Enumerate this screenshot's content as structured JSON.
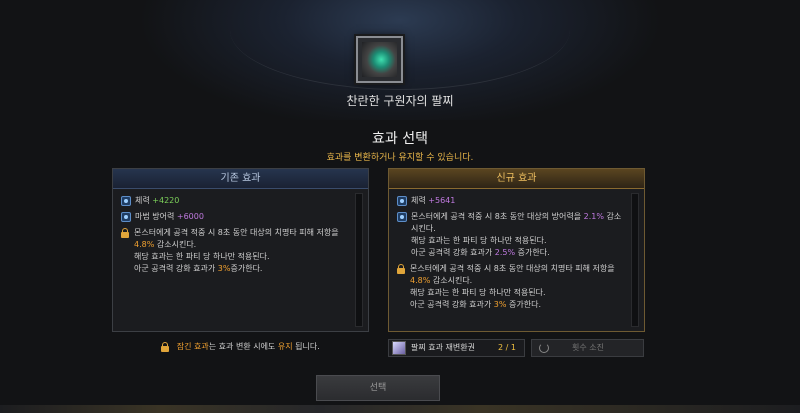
{
  "item": {
    "name": "찬란한 구원자의 팔찌",
    "icon": "bracelet-icon"
  },
  "header": {
    "title": "효과 선택",
    "subtitle": "효과를 변환하거나 유지할 수 있습니다."
  },
  "existing": {
    "header": "기존 효과",
    "lines": [
      {
        "label": "체력",
        "value": "+4220"
      },
      {
        "label": "마법 방어력",
        "value": "+6000"
      }
    ],
    "locked": {
      "line1": "몬스터에게 공격 적중 시 8초 동안 대상의 치명타 피해 저항을",
      "pct": "4.8%",
      "line2": "감소시킨다.",
      "line3": "해당 효과는 한 파티 당 하나만 적용된다.",
      "line4a": "아군 공격력 강화 효과가",
      "line4pct": "3%",
      "line4b": "증가한다."
    }
  },
  "new": {
    "header": "신규 효과",
    "stat": {
      "label": "체력",
      "value": "+5641"
    },
    "effect": {
      "line1a": "몬스터에게 공격 적중 시 8초 동안 대상의 방어력을",
      "pct": "2.1%",
      "line1b": "감소",
      "line2": "시킨다.",
      "line3": "해당 효과는 한 파티 당 하나만 적용된다.",
      "line4a": "아군 공격력 강화 효과가",
      "line4pct": "2.5%",
      "line4b": "증가한다."
    },
    "locked": {
      "line1": "몬스터에게 공격 적중 시 8초 동안 대상의 치명타 피해 저항을",
      "pct": "4.8%",
      "line2": "감소시킨다.",
      "line3": "해당 효과는 한 파티 당 하나만 적용된다.",
      "line4a": "아군 공격력 강화 효과가",
      "line4pct": "3%",
      "line4b": "증가한다."
    }
  },
  "note": {
    "a": "잠긴 효과",
    "b": "는 효과 변환 시에도",
    "c": "유지",
    "d": "됩니다."
  },
  "coupon": {
    "label": "팔찌 효과 재변환권",
    "count": "2 / 1"
  },
  "use": {
    "label": "횟수 소진"
  },
  "select": {
    "label": "선택"
  },
  "colors": {
    "accent": "#e8b64a",
    "green": "#7cd05a",
    "purple": "#c07ae0",
    "orange": "#f0a030"
  }
}
